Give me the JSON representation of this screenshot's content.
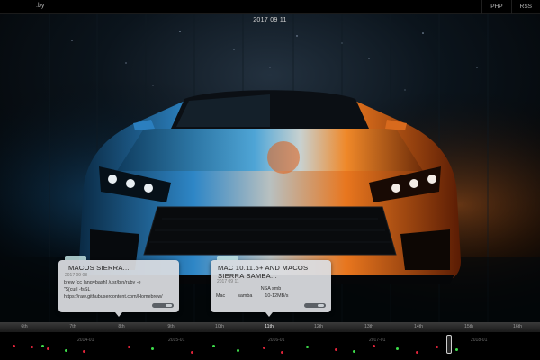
{
  "header": {
    "brand": ":by",
    "nav": [
      {
        "label": "PHP"
      },
      {
        "label": "RSS"
      }
    ]
  },
  "page": {
    "date": "2017 09 11"
  },
  "cards": [
    {
      "title": "MACOS SIERRA...",
      "date": "2017 09 08",
      "body": [
        "brew [cc lang=bash] /usr/bin/ruby -e",
        "\"$(curl -fsSL",
        "https://raw.githubusercontent.com/Homebrew/"
      ]
    },
    {
      "title_line1": "MAC   10.11.5+ AND MACOS",
      "title_line2": "SIERRA    SAMBA...",
      "date": "2017 09 11",
      "body_line1": "NSA  smb",
      "body_col1": "Mac",
      "body_col2": "samba",
      "body_col3": "10-12MB/s"
    }
  ],
  "timeline": {
    "days": [
      "6th",
      "7th",
      "8th",
      "9th",
      "10th",
      "11th",
      "12th",
      "13th",
      "14th",
      "15th",
      "16th"
    ],
    "active_day": "11th",
    "years": [
      "2014-01",
      "2015-01",
      "2016-01",
      "2017-01",
      "2018-01"
    ]
  },
  "colors": {
    "accent_green": "#3ddc4a",
    "accent_red": "#e0243a"
  }
}
